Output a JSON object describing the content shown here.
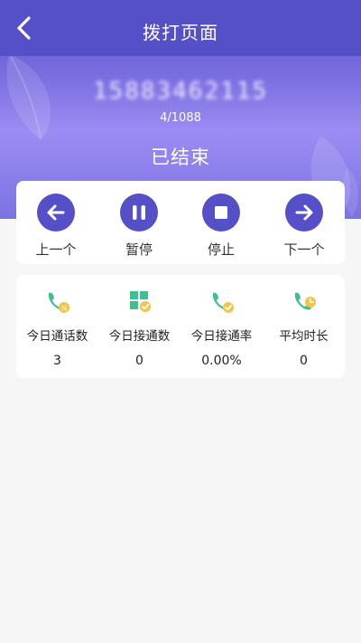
{
  "header": {
    "title": "拨打页面",
    "phone_number": "15883462115",
    "counter": "4/1088",
    "status": "已结束"
  },
  "controls": [
    {
      "label": "上一个",
      "icon": "arrow-left-icon"
    },
    {
      "label": "暂停",
      "icon": "pause-icon"
    },
    {
      "label": "停止",
      "icon": "stop-icon"
    },
    {
      "label": "下一个",
      "icon": "arrow-right-icon"
    }
  ],
  "stats": [
    {
      "label": "今日通话数",
      "value": "3",
      "icon": "phone-n-icon"
    },
    {
      "label": "今日接通数",
      "value": "0",
      "icon": "grid-check-icon"
    },
    {
      "label": "今日接通率",
      "value": "0.00%",
      "icon": "phone-check-icon"
    },
    {
      "label": "平均时长",
      "value": "0",
      "icon": "phone-clock-icon"
    }
  ],
  "colors": {
    "primary": "#5650c8",
    "green": "#3fbf8f",
    "yellow": "#f3c44a"
  }
}
